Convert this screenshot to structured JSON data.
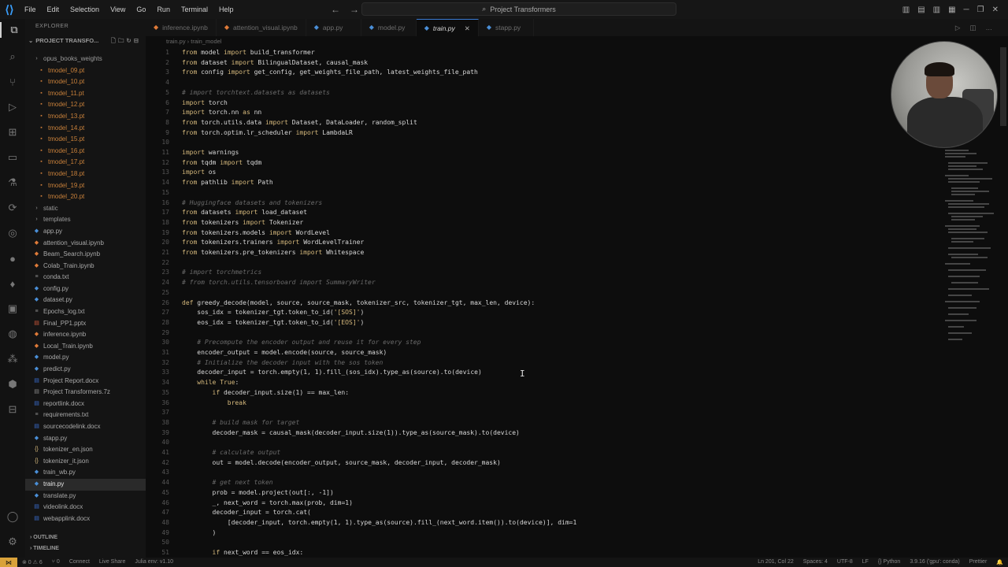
{
  "titlebar": {
    "menu": [
      "File",
      "Edit",
      "Selection",
      "View",
      "Go",
      "Run",
      "Terminal",
      "Help"
    ],
    "search": "Project Transformers"
  },
  "sidebar": {
    "title": "EXPLORER",
    "project": "PROJECT TRANSFO...",
    "tree": [
      {
        "label": "opus_books_weights",
        "kind": "folder",
        "indent": 1
      },
      {
        "label": "tmodel_09.pt",
        "kind": "pt",
        "indent": 2
      },
      {
        "label": "tmodel_10.pt",
        "kind": "pt",
        "indent": 2
      },
      {
        "label": "tmodel_11.pt",
        "kind": "pt",
        "indent": 2
      },
      {
        "label": "tmodel_12.pt",
        "kind": "pt",
        "indent": 2
      },
      {
        "label": "tmodel_13.pt",
        "kind": "pt",
        "indent": 2
      },
      {
        "label": "tmodel_14.pt",
        "kind": "pt",
        "indent": 2
      },
      {
        "label": "tmodel_15.pt",
        "kind": "pt",
        "indent": 2
      },
      {
        "label": "tmodel_16.pt",
        "kind": "pt",
        "indent": 2
      },
      {
        "label": "tmodel_17.pt",
        "kind": "pt",
        "indent": 2
      },
      {
        "label": "tmodel_18.pt",
        "kind": "pt",
        "indent": 2
      },
      {
        "label": "tmodel_19.pt",
        "kind": "pt",
        "indent": 2
      },
      {
        "label": "tmodel_20.pt",
        "kind": "pt",
        "indent": 2
      },
      {
        "label": "static",
        "kind": "folder",
        "indent": 1
      },
      {
        "label": "templates",
        "kind": "folder",
        "indent": 1
      },
      {
        "label": "app.py",
        "kind": "py",
        "indent": 1
      },
      {
        "label": "attention_visual.ipynb",
        "kind": "ipynb",
        "indent": 1
      },
      {
        "label": "Beam_Search.ipynb",
        "kind": "ipynb",
        "indent": 1
      },
      {
        "label": "Colab_Train.ipynb",
        "kind": "ipynb",
        "indent": 1
      },
      {
        "label": "conda.txt",
        "kind": "txt",
        "indent": 1
      },
      {
        "label": "config.py",
        "kind": "py",
        "indent": 1
      },
      {
        "label": "dataset.py",
        "kind": "py",
        "indent": 1
      },
      {
        "label": "Epochs_log.txt",
        "kind": "txt",
        "indent": 1
      },
      {
        "label": "Final_PP1.pptx",
        "kind": "pptx",
        "indent": 1
      },
      {
        "label": "inference.ipynb",
        "kind": "ipynb",
        "indent": 1
      },
      {
        "label": "Local_Train.ipynb",
        "kind": "ipynb",
        "indent": 1
      },
      {
        "label": "model.py",
        "kind": "py",
        "indent": 1
      },
      {
        "label": "predict.py",
        "kind": "py",
        "indent": 1
      },
      {
        "label": "Project Report.docx",
        "kind": "docx",
        "indent": 1
      },
      {
        "label": "Project Transformers.7z",
        "kind": "7z",
        "indent": 1
      },
      {
        "label": "reportlink.docx",
        "kind": "docx",
        "indent": 1
      },
      {
        "label": "requirements.txt",
        "kind": "txt",
        "indent": 1
      },
      {
        "label": "sourcecodelink.docx",
        "kind": "docx",
        "indent": 1
      },
      {
        "label": "stapp.py",
        "kind": "py",
        "indent": 1
      },
      {
        "label": "tokenizer_en.json",
        "kind": "json",
        "indent": 1
      },
      {
        "label": "tokenizer_it.json",
        "kind": "json",
        "indent": 1
      },
      {
        "label": "train_wb.py",
        "kind": "py",
        "indent": 1
      },
      {
        "label": "train.py",
        "kind": "py",
        "indent": 1,
        "selected": true
      },
      {
        "label": "translate.py",
        "kind": "py",
        "indent": 1
      },
      {
        "label": "videolink.docx",
        "kind": "docx",
        "indent": 1
      },
      {
        "label": "webapplink.docx",
        "kind": "docx",
        "indent": 1
      }
    ],
    "outline": "OUTLINE",
    "timeline": "TIMELINE"
  },
  "tabs": [
    {
      "label": "inference.ipynb",
      "active": false
    },
    {
      "label": "attention_visual.ipynb",
      "active": false
    },
    {
      "label": "app.py",
      "active": false
    },
    {
      "label": "model.py",
      "active": false
    },
    {
      "label": "train.py",
      "active": true
    },
    {
      "label": "stapp.py",
      "active": false
    }
  ],
  "breadcrumbs": "train.py  ›  train_model",
  "code": [
    {
      "n": "1",
      "t": "from model import build_transformer",
      "k": "imp"
    },
    {
      "n": "2",
      "t": "from dataset import BilingualDataset, causal_mask",
      "k": "imp"
    },
    {
      "n": "3",
      "t": "from config import get_config, get_weights_file_path, latest_weights_file_path",
      "k": "imp"
    },
    {
      "n": "4",
      "t": "",
      "k": ""
    },
    {
      "n": "5",
      "t": "# import torchtext.datasets as datasets",
      "k": "cm"
    },
    {
      "n": "6",
      "t": "import torch",
      "k": "imp"
    },
    {
      "n": "7",
      "t": "import torch.nn as nn",
      "k": "imp"
    },
    {
      "n": "8",
      "t": "from torch.utils.data import Dataset, DataLoader, random_split",
      "k": "imp"
    },
    {
      "n": "9",
      "t": "from torch.optim.lr_scheduler import LambdaLR",
      "k": "imp"
    },
    {
      "n": "10",
      "t": "",
      "k": ""
    },
    {
      "n": "11",
      "t": "import warnings",
      "k": "imp"
    },
    {
      "n": "12",
      "t": "from tqdm import tqdm",
      "k": "imp"
    },
    {
      "n": "13",
      "t": "import os",
      "k": "imp"
    },
    {
      "n": "14",
      "t": "from pathlib import Path",
      "k": "imp"
    },
    {
      "n": "15",
      "t": "",
      "k": ""
    },
    {
      "n": "16",
      "t": "# Huggingface datasets and tokenizers",
      "k": "cm"
    },
    {
      "n": "17",
      "t": "from datasets import load_dataset",
      "k": "imp"
    },
    {
      "n": "18",
      "t": "from tokenizers import Tokenizer",
      "k": "imp"
    },
    {
      "n": "19",
      "t": "from tokenizers.models import WordLevel",
      "k": "imp"
    },
    {
      "n": "20",
      "t": "from tokenizers.trainers import WordLevelTrainer",
      "k": "imp"
    },
    {
      "n": "21",
      "t": "from tokenizers.pre_tokenizers import Whitespace",
      "k": "imp"
    },
    {
      "n": "22",
      "t": "",
      "k": ""
    },
    {
      "n": "23",
      "t": "# import torchmetrics",
      "k": "cm"
    },
    {
      "n": "24",
      "t": "# from torch.utils.tensorboard import SummaryWriter",
      "k": "cm"
    },
    {
      "n": "25",
      "t": "",
      "k": ""
    },
    {
      "n": "26",
      "t": "def greedy_decode(model, source, source_mask, tokenizer_src, tokenizer_tgt, max_len, device):",
      "k": "def"
    },
    {
      "n": "27",
      "t": "    sos_idx = tokenizer_tgt.token_to_id('[SOS]')",
      "k": ""
    },
    {
      "n": "28",
      "t": "    eos_idx = tokenizer_tgt.token_to_id('[EOS]')",
      "k": ""
    },
    {
      "n": "29",
      "t": "",
      "k": ""
    },
    {
      "n": "30",
      "t": "    # Precompute the encoder output and reuse it for every step",
      "k": "cm"
    },
    {
      "n": "31",
      "t": "    encoder_output = model.encode(source, source_mask)",
      "k": ""
    },
    {
      "n": "32",
      "t": "    # Initialize the decoder input with the sos token",
      "k": "cm"
    },
    {
      "n": "33",
      "t": "    decoder_input = torch.empty(1, 1).fill_(sos_idx).type_as(source).to(device)",
      "k": ""
    },
    {
      "n": "34",
      "t": "    while True:",
      "k": "kwline"
    },
    {
      "n": "35",
      "t": "        if decoder_input.size(1) == max_len:",
      "k": "kwline"
    },
    {
      "n": "36",
      "t": "            break",
      "k": "kwline"
    },
    {
      "n": "37",
      "t": "",
      "k": ""
    },
    {
      "n": "38",
      "t": "        # build mask for target",
      "k": "cm"
    },
    {
      "n": "39",
      "t": "        decoder_mask = causal_mask(decoder_input.size(1)).type_as(source_mask).to(device)",
      "k": ""
    },
    {
      "n": "40",
      "t": "",
      "k": ""
    },
    {
      "n": "41",
      "t": "        # calculate output",
      "k": "cm"
    },
    {
      "n": "42",
      "t": "        out = model.decode(encoder_output, source_mask, decoder_input, decoder_mask)",
      "k": ""
    },
    {
      "n": "43",
      "t": "",
      "k": ""
    },
    {
      "n": "44",
      "t": "        # get next token",
      "k": "cm"
    },
    {
      "n": "45",
      "t": "        prob = model.project(out[:, -1])",
      "k": ""
    },
    {
      "n": "46",
      "t": "        _, next_word = torch.max(prob, dim=1)",
      "k": ""
    },
    {
      "n": "47",
      "t": "        decoder_input = torch.cat(",
      "k": ""
    },
    {
      "n": "48",
      "t": "            [decoder_input, torch.empty(1, 1).type_as(source).fill_(next_word.item()).to(device)], dim=1",
      "k": ""
    },
    {
      "n": "49",
      "t": "        )",
      "k": ""
    },
    {
      "n": "50",
      "t": "",
      "k": ""
    },
    {
      "n": "51",
      "t": "        if next_word == eos_idx:",
      "k": "kwline"
    }
  ],
  "status": {
    "left": [
      "⊗ 0  ⚠ 6",
      "⑂ 0",
      "Connect",
      "Live Share",
      "Julia env: v1.10"
    ],
    "right": [
      "Ln 201, Col 22",
      "Spaces: 4",
      "UTF-8",
      "LF",
      "{} Python",
      "3.9.16 ('gpu': conda)",
      "Prettier"
    ]
  },
  "colors": {
    "accent": "#3a7bd5",
    "keyword": "#d7ba7d",
    "remote": "#d9a23a"
  }
}
